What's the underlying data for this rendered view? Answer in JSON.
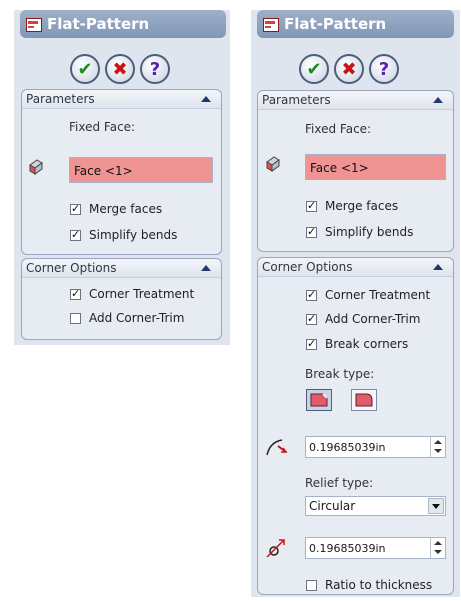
{
  "left_panel": {
    "title": "Flat-Pattern",
    "parameters": {
      "header": "Parameters",
      "fixed_face_label": "Fixed Face:",
      "face_value": "Face <1>",
      "merge_faces": {
        "label": "Merge faces",
        "checked": true
      },
      "simplify_bends": {
        "label": "Simplify bends",
        "checked": true
      }
    },
    "corner_options": {
      "header": "Corner Options",
      "corner_treatment": {
        "label": "Corner Treatment",
        "checked": true
      },
      "add_corner_trim": {
        "label": "Add Corner-Trim",
        "checked": false
      }
    }
  },
  "right_panel": {
    "title": "Flat-Pattern",
    "parameters": {
      "header": "Parameters",
      "fixed_face_label": "Fixed Face:",
      "face_value": "Face <1>",
      "merge_faces": {
        "label": "Merge faces",
        "checked": true
      },
      "simplify_bends": {
        "label": "Simplify bends",
        "checked": true
      }
    },
    "corner_options": {
      "header": "Corner Options",
      "corner_treatment": {
        "label": "Corner Treatment",
        "checked": true
      },
      "add_corner_trim": {
        "label": "Add Corner-Trim",
        "checked": true
      },
      "break_corners": {
        "label": "Break corners",
        "checked": true
      },
      "break_type_label": "Break type:",
      "break_distance": "0.19685039in",
      "relief_type_label": "Relief type:",
      "relief_type_value": "Circular",
      "relief_size": "0.19685039in",
      "ratio_to_thickness": {
        "label": "Ratio to thickness",
        "checked": false
      }
    }
  },
  "buttons": {
    "ok_glyph": "✔",
    "cancel_glyph": "✖",
    "help_glyph": "?"
  },
  "colors": {
    "title_bar": "#8ea2bf",
    "face_field": "#f09393",
    "panel_bg": "#dfe5ef"
  }
}
